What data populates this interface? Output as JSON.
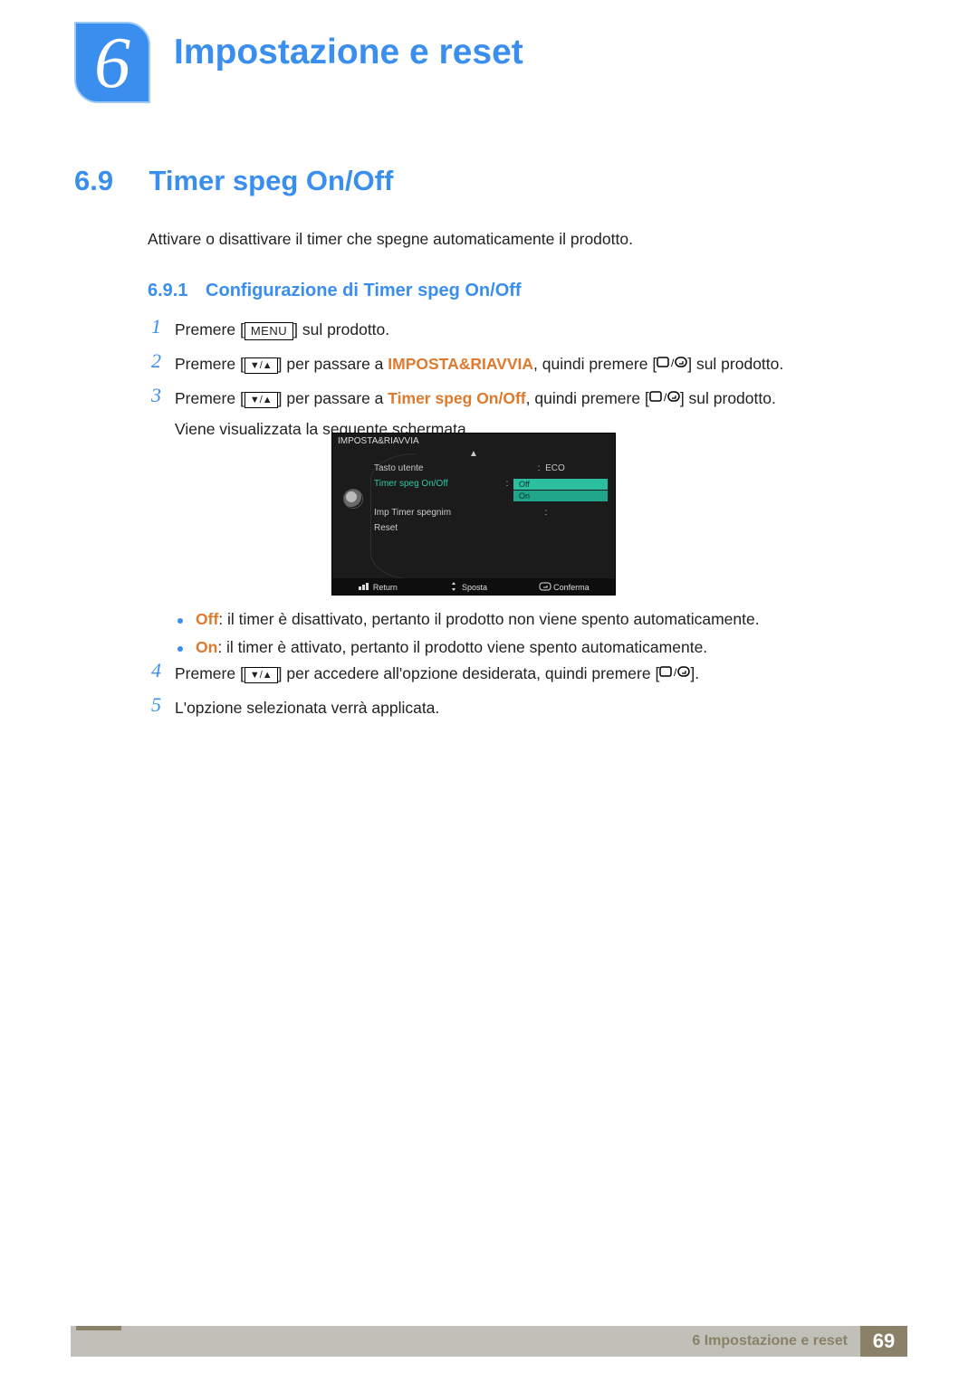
{
  "chapter": {
    "number": "6",
    "title": "Impostazione e reset"
  },
  "section": {
    "number": "6.9",
    "title": "Timer speg On/Off"
  },
  "intro": "Attivare o disattivare il timer che spegne automaticamente il prodotto.",
  "subsection": {
    "number": "6.9.1",
    "title": "Configurazione di Timer speg On/Off"
  },
  "buttons": {
    "menu": "MENU",
    "updown": "▼/▲"
  },
  "steps": {
    "s1": {
      "n": "1",
      "a": "Premere [",
      "b": "] sul prodotto."
    },
    "s2": {
      "n": "2",
      "a": "Premere [",
      "b": "] per passare a ",
      "kw": "IMPOSTA&RIAVVIA",
      "c": ", quindi premere [",
      "d": "] sul prodotto."
    },
    "s3": {
      "n": "3",
      "a": "Premere [",
      "b": "] per passare a ",
      "kw": "Timer speg On/Off",
      "c": ", quindi premere [",
      "d": "] sul prodotto."
    },
    "note3": "Viene visualizzata la seguente schermata.",
    "s4": {
      "n": "4",
      "a": "Premere [",
      "b": "] per accedere all'opzione desiderata, quindi premere [",
      "c": "]."
    },
    "s5": {
      "n": "5",
      "a": "L'opzione selezionata verrà applicata."
    }
  },
  "bullets": {
    "off_label": "Off",
    "off_text": ": il timer è disattivato, pertanto il prodotto non viene spento automaticamente.",
    "on_label": "On",
    "on_text": ": il timer è attivato, pertanto il prodotto viene spento automaticamente."
  },
  "osd": {
    "title": "IMPOSTA&RIAVVIA",
    "arrow_up": "▲",
    "items": {
      "i1": {
        "label": "Tasto utente",
        "value": "ECO"
      },
      "i2": {
        "label": "Timer speg On/Off"
      },
      "i3": {
        "label": "Imp Timer spegnim",
        "value": ""
      },
      "i4": {
        "label": "Reset"
      }
    },
    "opts": {
      "off": "Off",
      "on": "On"
    },
    "footer": {
      "return": "Return",
      "move": "Sposta",
      "confirm": "Conferma"
    }
  },
  "footer": {
    "label": "6 Impostazione e reset",
    "page": "69"
  }
}
